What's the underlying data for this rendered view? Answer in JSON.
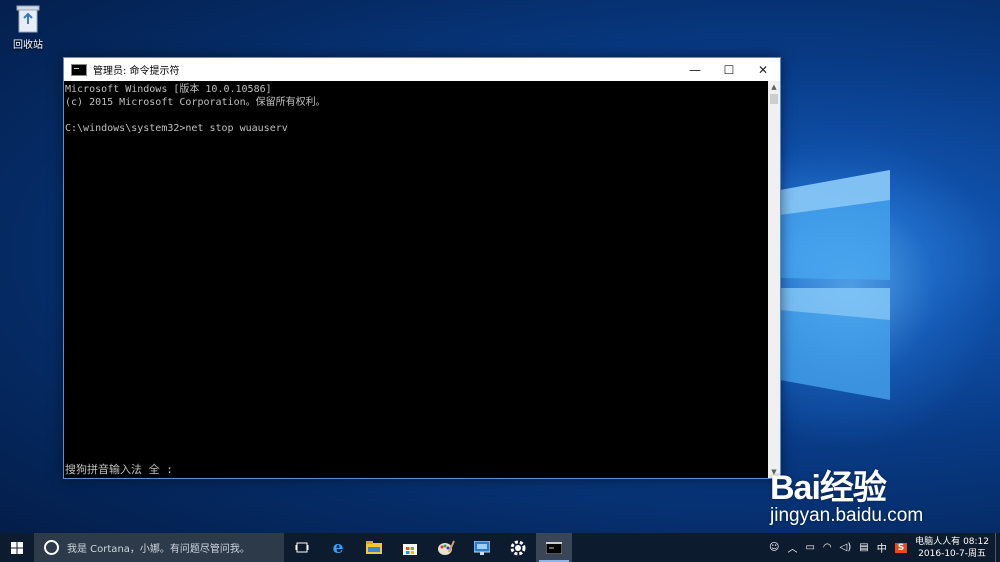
{
  "desktop": {
    "recycle_bin_label": "回收站"
  },
  "window": {
    "title": "管理员: 命令提示符",
    "controls": {
      "minimize": "—",
      "maximize": "☐",
      "close": "✕"
    }
  },
  "console": {
    "lines": [
      "Microsoft Windows [版本 10.0.10586]",
      "(c) 2015 Microsoft Corporation。保留所有权利。",
      "",
      "C:\\windows\\system32>net stop wuauserv"
    ],
    "ime_status": "搜狗拼音输入法 全 :"
  },
  "taskbar": {
    "search_placeholder": "我是 Cortana，小娜。有问题尽管问我。",
    "apps": [
      "task-view-icon",
      "edge-icon",
      "file-explorer-icon",
      "store-icon",
      "paint-icon",
      "remote-desktop-icon",
      "settings-icon",
      "cmd-icon"
    ],
    "tray": {
      "input_lang": "中",
      "user": "电脑人人有",
      "time": "08:12",
      "date": "2016-10-7-周五"
    }
  },
  "watermark": {
    "brand": "Bai经验",
    "url": "jingyan.baidu.com"
  }
}
